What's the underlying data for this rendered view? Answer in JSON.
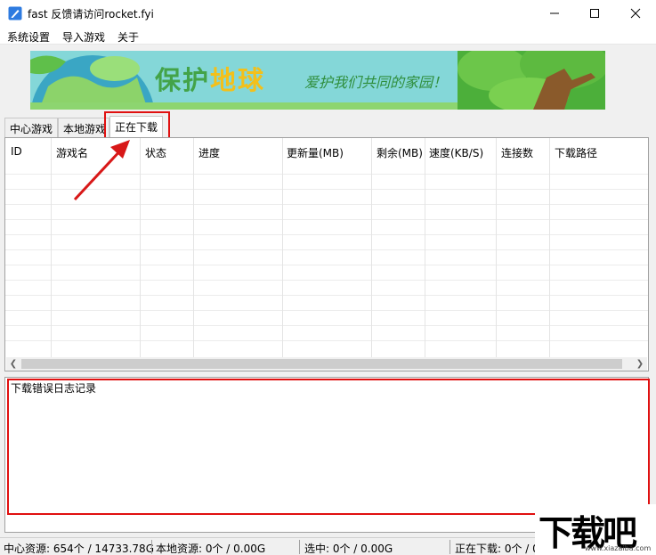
{
  "window": {
    "title": "fast 反馈请访问rocket.fyi"
  },
  "menu": {
    "items": [
      "系统设置",
      "导入游戏",
      "关于"
    ]
  },
  "banner": {
    "title_part1": "保护",
    "title_part2": "地球",
    "subtitle": "爱护我们共同的家园！"
  },
  "tabs": [
    {
      "label": "中心游戏",
      "active": false
    },
    {
      "label": "本地游戏",
      "active": false
    },
    {
      "label": "正在下载",
      "active": true
    }
  ],
  "download_table": {
    "columns": [
      "ID",
      "游戏名",
      "状态",
      "进度",
      "更新量(MB)",
      "剩余(MB)",
      "速度(KB/S)",
      "连接数",
      "下载路径"
    ],
    "rows": []
  },
  "log": {
    "label": "下载错误日志记录"
  },
  "status": {
    "center_resources": "中心资源: 654个 / 14733.78G",
    "local_resources": "本地资源: 0个 / 0.00G",
    "selected": "选中: 0个 / 0.00G",
    "downloading": "正在下载: 0个 / 0"
  },
  "watermark": {
    "text": "下载吧",
    "url": "www.xiazaiba.com"
  },
  "colors": {
    "highlight": "#e01010",
    "banner_green": "#43a348",
    "banner_orange": "#f3c01a"
  }
}
